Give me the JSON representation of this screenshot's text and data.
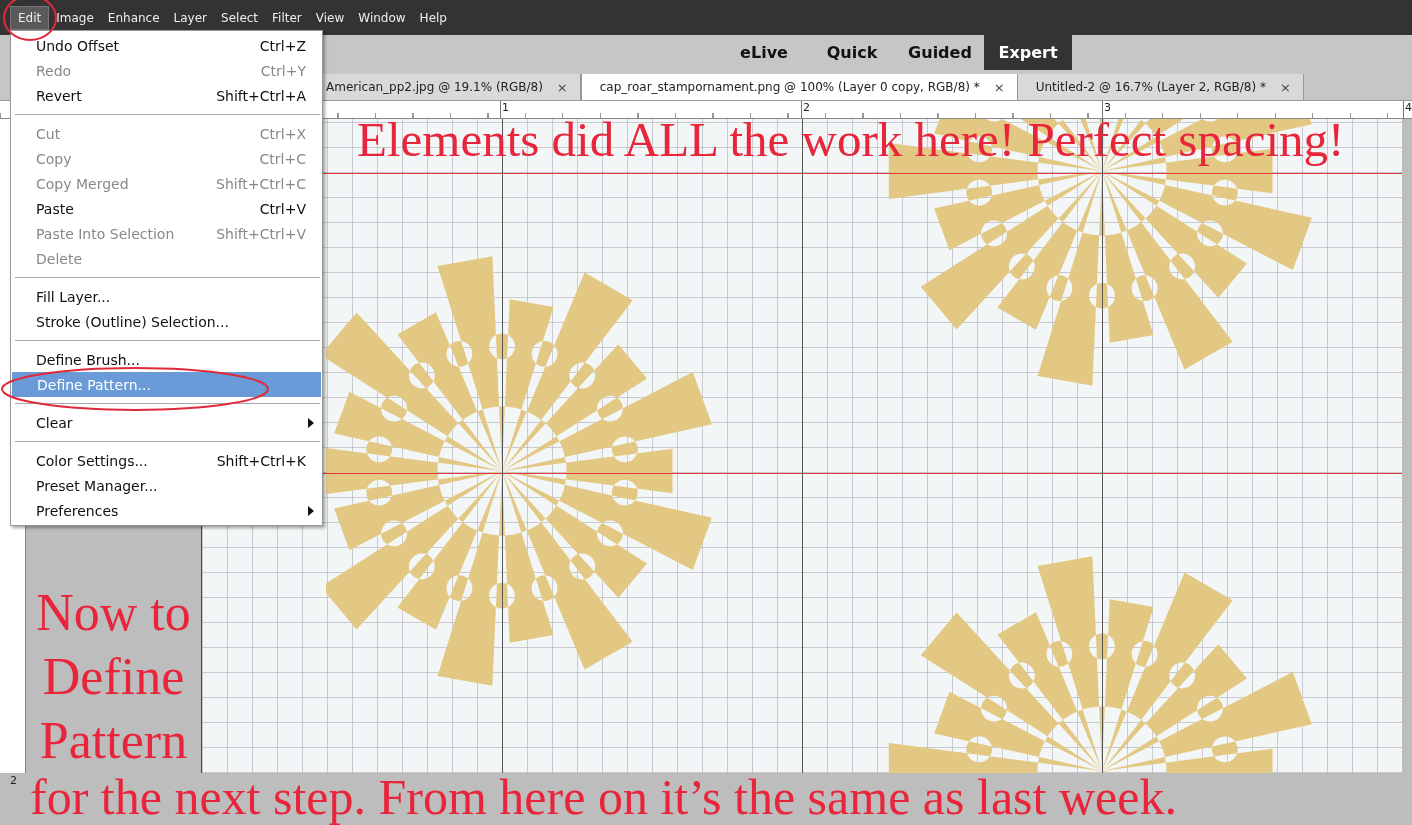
{
  "menubar": [
    {
      "label": "Edit",
      "selected": true
    },
    {
      "label": "Image",
      "selected": false
    },
    {
      "label": "Enhance",
      "selected": false
    },
    {
      "label": "Layer",
      "selected": false
    },
    {
      "label": "Select",
      "selected": false
    },
    {
      "label": "Filter",
      "selected": false
    },
    {
      "label": "View",
      "selected": false
    },
    {
      "label": "Window",
      "selected": false
    },
    {
      "label": "Help",
      "selected": false
    }
  ],
  "mode_tabs": [
    {
      "label": "eLive",
      "selected": false
    },
    {
      "label": "Quick",
      "selected": false
    },
    {
      "label": "Guided",
      "selected": false
    },
    {
      "label": "Expert",
      "selected": true
    }
  ],
  "document_tabs": [
    {
      "label": "American_pp2.jpg @ 19.1% (RGB/8)",
      "close": "×",
      "selected": false
    },
    {
      "label": "cap_roar_stampornament.png @ 100% (Layer 0 copy, RGB/8) *",
      "close": "×",
      "selected": true
    },
    {
      "label": "Untitled-2 @ 16.7% (Layer 2, RGB/8) *",
      "close": "×",
      "selected": false
    }
  ],
  "ruler": {
    "top_labels": [
      "1",
      "2",
      "3",
      "4"
    ],
    "left_label": "2"
  },
  "edit_menu": [
    {
      "kind": "item",
      "label": "Undo Offset",
      "shortcut": "Ctrl+Z",
      "disabled": false,
      "selected": false,
      "submenu": false
    },
    {
      "kind": "item",
      "label": "Redo",
      "shortcut": "Ctrl+Y",
      "disabled": true,
      "selected": false,
      "submenu": false
    },
    {
      "kind": "item",
      "label": "Revert",
      "shortcut": "Shift+Ctrl+A",
      "disabled": false,
      "selected": false,
      "submenu": false
    },
    {
      "kind": "separator"
    },
    {
      "kind": "item",
      "label": "Cut",
      "shortcut": "Ctrl+X",
      "disabled": true,
      "selected": false,
      "submenu": false
    },
    {
      "kind": "item",
      "label": "Copy",
      "shortcut": "Ctrl+C",
      "disabled": true,
      "selected": false,
      "submenu": false
    },
    {
      "kind": "item",
      "label": "Copy Merged",
      "shortcut": "Shift+Ctrl+C",
      "disabled": true,
      "selected": false,
      "submenu": false
    },
    {
      "kind": "item",
      "label": "Paste",
      "shortcut": "Ctrl+V",
      "disabled": false,
      "selected": false,
      "submenu": false
    },
    {
      "kind": "item",
      "label": "Paste Into Selection",
      "shortcut": "Shift+Ctrl+V",
      "disabled": true,
      "selected": false,
      "submenu": false
    },
    {
      "kind": "item",
      "label": "Delete",
      "disabled": true,
      "selected": false,
      "submenu": false
    },
    {
      "kind": "separator"
    },
    {
      "kind": "item",
      "label": "Fill Layer...",
      "disabled": false,
      "selected": false,
      "submenu": false
    },
    {
      "kind": "item",
      "label": "Stroke (Outline) Selection...",
      "disabled": false,
      "selected": false,
      "submenu": false
    },
    {
      "kind": "separator"
    },
    {
      "kind": "item",
      "label": "Define Brush...",
      "disabled": false,
      "selected": false,
      "submenu": false
    },
    {
      "kind": "item",
      "label": "Define Pattern...",
      "disabled": false,
      "selected": true,
      "submenu": false
    },
    {
      "kind": "separator"
    },
    {
      "kind": "item",
      "label": "Clear",
      "disabled": false,
      "selected": false,
      "submenu": true
    },
    {
      "kind": "separator"
    },
    {
      "kind": "item",
      "label": "Color Settings...",
      "shortcut": "Shift+Ctrl+K",
      "disabled": false,
      "selected": false,
      "submenu": false
    },
    {
      "kind": "item",
      "label": "Preset Manager...",
      "disabled": false,
      "selected": false,
      "submenu": false
    },
    {
      "kind": "item",
      "label": "Preferences",
      "disabled": false,
      "selected": false,
      "submenu": true
    }
  ],
  "annotations": {
    "top": "Elements did ALL the work here! Perfect spacing!",
    "left": "Now to Define Pattern",
    "bottom": "for the next step. From here on it’s the same as last week."
  }
}
